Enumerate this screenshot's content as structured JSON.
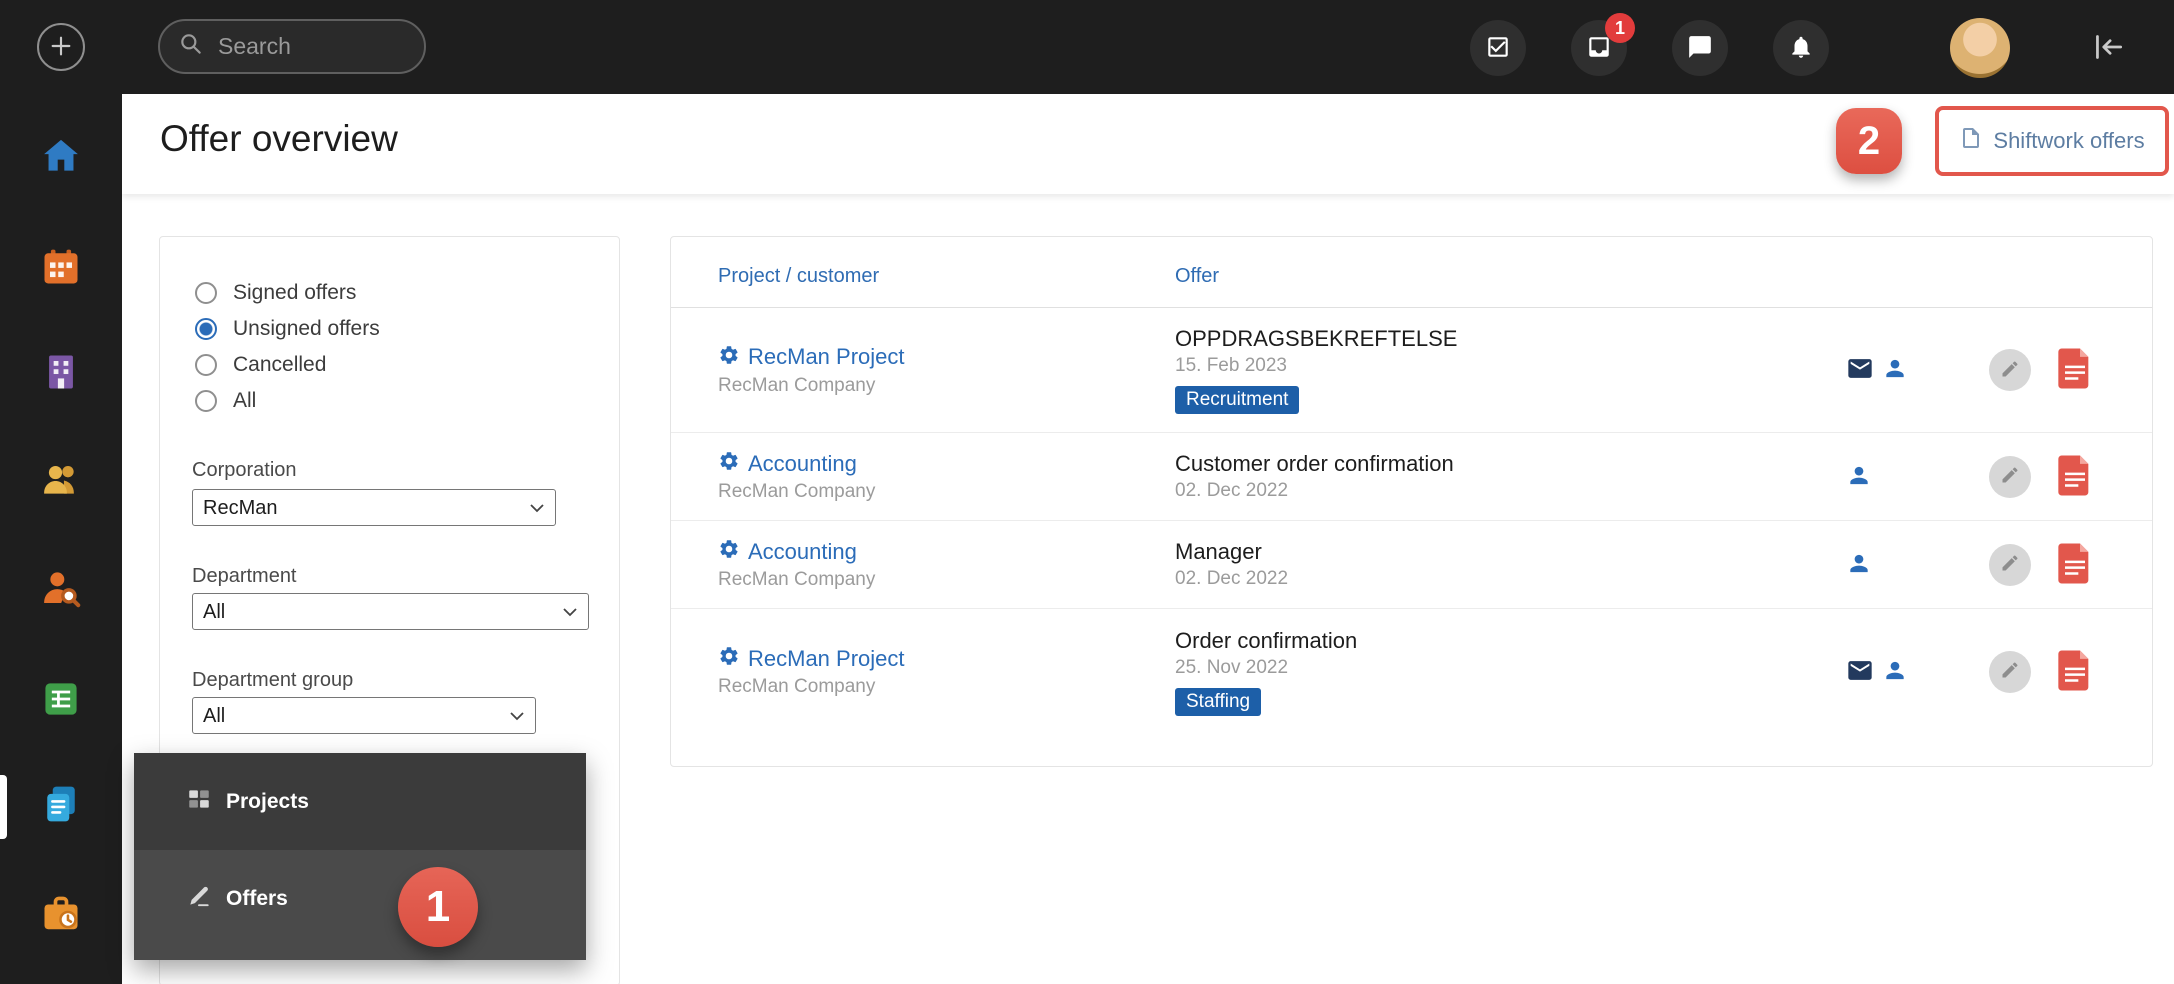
{
  "topbar": {
    "search_placeholder": "Search",
    "inbox_badge_count": "1"
  },
  "header": {
    "title": "Offer overview",
    "shiftwork_offers_label": "Shiftwork offers"
  },
  "annotations": {
    "step_1": "1",
    "step_2": "2"
  },
  "filters": {
    "options": [
      {
        "label": "Signed offers",
        "selected": false
      },
      {
        "label": "Unsigned offers",
        "selected": true
      },
      {
        "label": "Cancelled",
        "selected": false
      },
      {
        "label": "All",
        "selected": false
      }
    ],
    "corporation_label": "Corporation",
    "corporation_value": "RecMan",
    "department_label": "Department",
    "department_value": "All",
    "department_group_label": "Department group",
    "department_group_value": "All"
  },
  "flyout": {
    "projects_label": "Projects",
    "offers_label": "Offers"
  },
  "table": {
    "col_project": "Project / customer",
    "col_offer": "Offer",
    "rows": [
      {
        "project": "RecMan Project",
        "company": "RecMan Company",
        "title": "OPPDRAGSBEKREFTELSE",
        "date": "15. Feb 2023",
        "badge": "Recruitment"
      },
      {
        "project": "Accounting",
        "company": "RecMan Company",
        "title": "Customer order confirmation",
        "date": "02. Dec 2022"
      },
      {
        "project": "Accounting",
        "company": "RecMan Company",
        "title": "Manager",
        "date": "02. Dec 2022"
      },
      {
        "project": "RecMan Project",
        "company": "RecMan Company",
        "title": "Order confirmation",
        "date": "25. Nov 2022",
        "badge": "Staffing"
      }
    ]
  },
  "icons": [
    "add-icon",
    "search-icon",
    "tasks-icon",
    "inbox-icon",
    "chat-icon",
    "bell-icon",
    "avatar",
    "collapse-left-icon",
    "home-icon",
    "schedule-icon",
    "company-icon",
    "people-icon",
    "candidate-search-icon",
    "spreadsheet-icon",
    "documents-icon",
    "worktime-icon",
    "projects-icon",
    "offers-pen-icon",
    "gear-icon",
    "mail-icon",
    "person-icon",
    "pencil-icon",
    "pdf-icon",
    "document-icon",
    "chevron-down-icon"
  ],
  "colors": {
    "topbar_dark": "#1e1e1e",
    "accent_blue": "#2b6cb8",
    "badge_blue": "#1d5fa8",
    "annotation_red": "#e2574c",
    "notification_red": "#e23c3c",
    "pdf_red": "#e2574c"
  }
}
